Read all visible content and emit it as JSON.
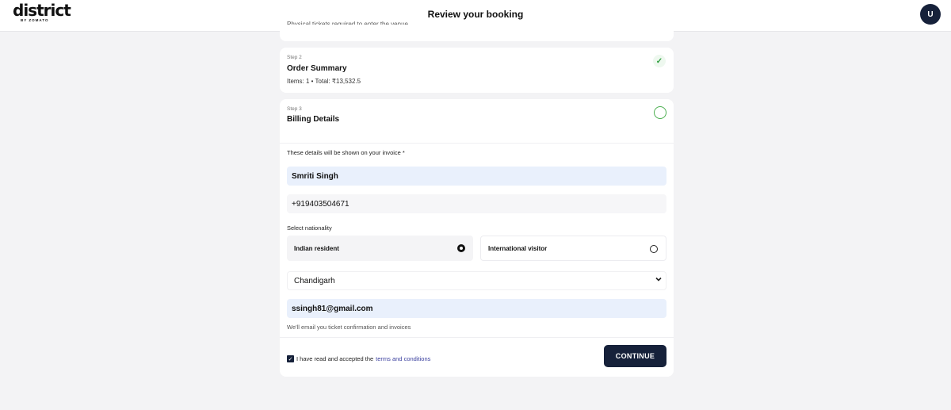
{
  "header": {
    "logo_text": "district",
    "logo_subtext": "BY ZOMATO",
    "title": "Review your booking",
    "avatar_initial": "U"
  },
  "step1": {
    "cut_text": "Physical tickets required to enter the venue"
  },
  "step2": {
    "step_label": "Step 2",
    "title": "Order Summary",
    "summary": "Items: 1 • Total: ₹13,532.5",
    "status_icon": "check-icon"
  },
  "step3": {
    "step_label": "Step 3",
    "title": "Billing Details",
    "invoice_label": "These details will be shown on your invoice *",
    "name_value": "Smriti Singh",
    "phone_value": "+919403504671",
    "nationality_label": "Select nationality",
    "nationality_options": [
      {
        "label": "Indian resident",
        "selected": true
      },
      {
        "label": "International visitor",
        "selected": false
      }
    ],
    "state_value": "Chandigarh",
    "email_value": "ssingh81@gmail.com",
    "email_hint": "We'll email you ticket confirmation and invoices",
    "terms_prefix": "I have read and accepted the",
    "terms_link": "terms and conditions",
    "terms_checked": true,
    "continue_label": "CONTINUE"
  },
  "colors": {
    "page_bg": "#f3f3f5",
    "primary": "#16213a",
    "filled_field": "#e9f0fc",
    "success": "#2e9e3e",
    "link": "#3a3f9e"
  }
}
